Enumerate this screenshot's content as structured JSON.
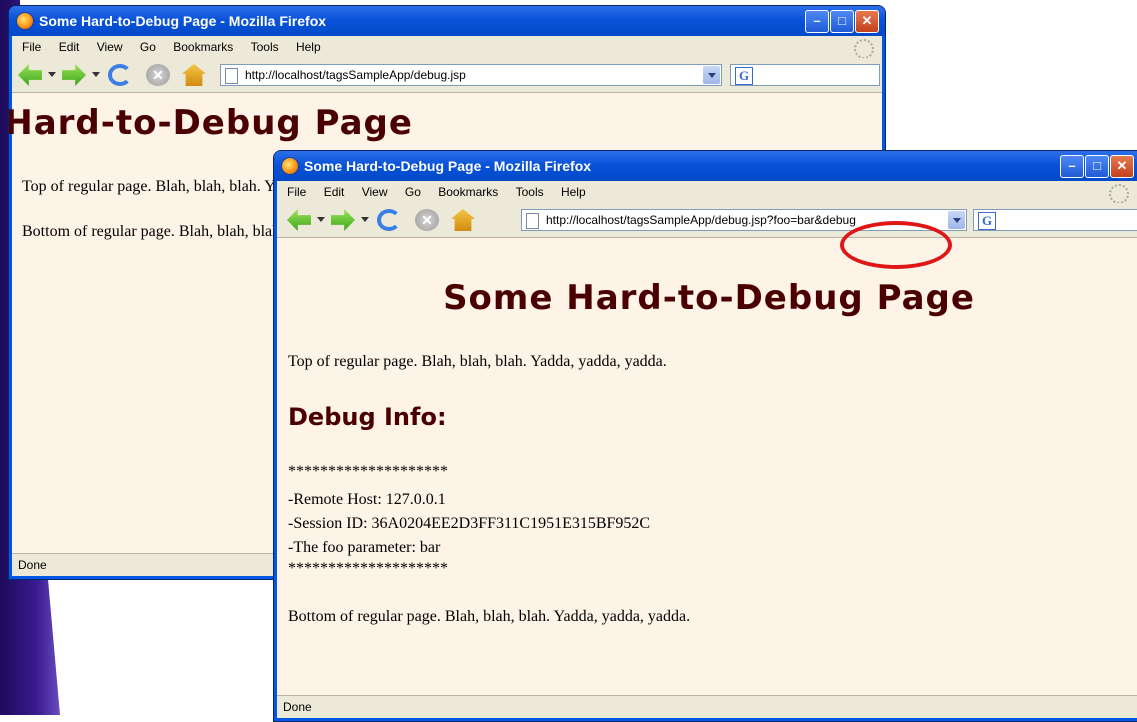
{
  "back_window": {
    "title": "Some Hard-to-Debug Page - Mozilla Firefox",
    "menu": [
      "File",
      "Edit",
      "View",
      "Go",
      "Bookmarks",
      "Tools",
      "Help"
    ],
    "url": "http://localhost/tagsSampleApp/debug.jsp",
    "heading": "Some Hard-to-Debug Page",
    "top_text": "Top of regular page. Blah, blah, blah. Yadda, yadda, yadda.",
    "bottom_text": "Bottom of regular page. Blah, blah, blah. Yadda, yadda, yadda.",
    "status": "Done"
  },
  "front_window": {
    "title": "Some Hard-to-Debug Page - Mozilla Firefox",
    "menu": [
      "File",
      "Edit",
      "View",
      "Go",
      "Bookmarks",
      "Tools",
      "Help"
    ],
    "url": "http://localhost/tagsSampleApp/debug.jsp?foo=bar&debug",
    "heading": "Some Hard-to-Debug Page",
    "top_text": "Top of regular page. Blah, blah, blah. Yadda, yadda, yadda.",
    "debug_heading": "Debug Info:",
    "stars": "********************",
    "remote_host": "-Remote Host: 127.0.0.1",
    "session_id": "-Session ID: 36A0204EE2D3FF311C1951E315BF952C",
    "foo_param": "-The foo parameter: bar",
    "bottom_text": "Bottom of regular page. Blah, blah, blah. Yadda, yadda, yadda.",
    "status": "Done"
  },
  "colors": {
    "heading": "#4a0000",
    "content_bg": "#fdf3e7",
    "highlight": "#e01515",
    "titlebar": "#0a53d9"
  }
}
